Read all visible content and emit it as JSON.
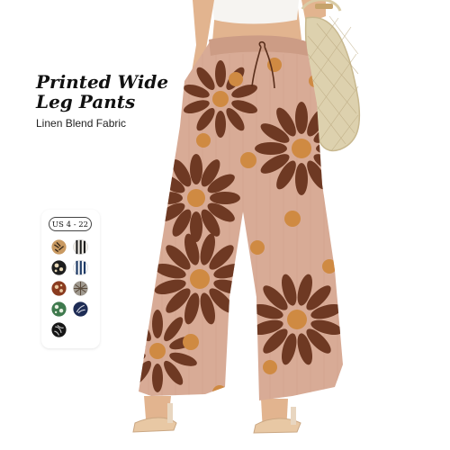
{
  "header": {
    "title": "Printed Wide Leg Pants",
    "subtitle": "Linen Blend Fabric"
  },
  "size_card": {
    "size_range": "US 4 - 22",
    "swatches": [
      {
        "name": "tan-leaf-print",
        "base": "#c99a62",
        "accent": "#3a2a1a"
      },
      {
        "name": "black-white-stripe-print",
        "base": "#f1ede6",
        "accent": "#1a1a1a"
      },
      {
        "name": "black-floral-print",
        "base": "#1e1e1e",
        "accent": "#e8d9b8"
      },
      {
        "name": "navy-white-stripe-print",
        "base": "#ffffff",
        "accent": "#1f3b66"
      },
      {
        "name": "brown-floral-print",
        "base": "#8a3b1f",
        "accent": "#e8c9a0"
      },
      {
        "name": "gray-plaid-print",
        "base": "#a09a90",
        "accent": "#5a4a3a"
      },
      {
        "name": "green-floral-print",
        "base": "#3f7a4e",
        "accent": "#e9efe2"
      },
      {
        "name": "navy-botanical-print",
        "base": "#1e2c55",
        "accent": "#d6d9e2"
      },
      {
        "name": "black-leaf-print",
        "base": "#161616",
        "accent": "#c9c9c9"
      }
    ]
  },
  "colors": {
    "fabric": "#d8ab96",
    "petal": "#6e3923",
    "dot": "#cf8a42",
    "bag": "#ddd1ae",
    "skin": "#e2b48f"
  }
}
